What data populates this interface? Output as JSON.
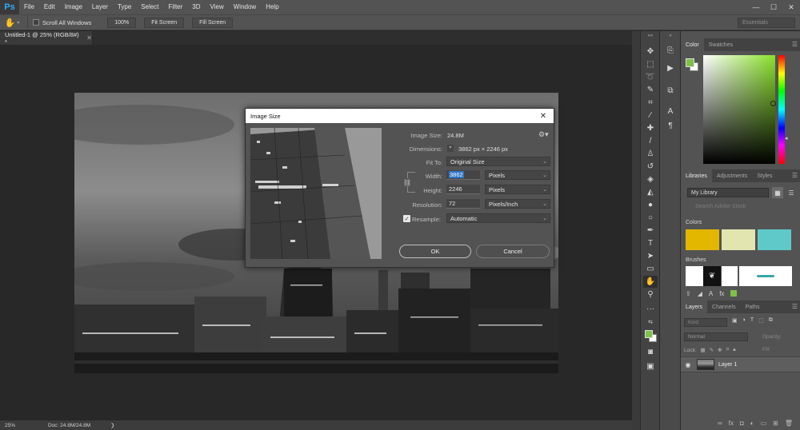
{
  "app": {
    "logo": "Ps"
  },
  "menu": [
    "File",
    "Edit",
    "Image",
    "Layer",
    "Type",
    "Select",
    "Filter",
    "3D",
    "View",
    "Window",
    "Help"
  ],
  "window_controls": {
    "minimize": "—",
    "maximize": "☐",
    "close": "✕"
  },
  "options_bar": {
    "scroll_all_label": "Scroll All Windows",
    "zoom_100_label": "100%",
    "fit_screen_label": "Fit Screen",
    "fill_screen_label": "Fill Screen",
    "workspace": "Essentials"
  },
  "document": {
    "tab_title": "Untitled-1 @ 25% (RGB/8#) *",
    "zoom": "25%",
    "doc_info": "Doc: 24.8M/24.8M"
  },
  "panels": {
    "color": {
      "tabs": [
        "Color",
        "Swatches"
      ],
      "foreground": "#7fc04a",
      "background": "#ffffff"
    },
    "libraries": {
      "tabs": [
        "Libraries",
        "Adjustments",
        "Styles"
      ],
      "selected_library": "My Library",
      "search_placeholder": "Search Adobe Stock",
      "colors_heading": "Colors",
      "colors": [
        "#e3b600",
        "#e3e5b0",
        "#5fc9c9"
      ],
      "brushes_heading": "Brushes"
    },
    "layers": {
      "tabs": [
        "Layers",
        "Channels",
        "Paths"
      ],
      "filter_label": "Kind",
      "blend_mode": "Normal",
      "opacity_label": "Opacity:",
      "lock_label": "Lock:",
      "fill_label": "Fill:",
      "layer_name": "Layer 1"
    }
  },
  "dialog": {
    "title": "Image Size",
    "image_size_label": "Image Size:",
    "image_size_value": "24.8M",
    "dimensions_label": "Dimensions:",
    "dimensions_value": "3862 px  ×  2246 px",
    "fit_to_label": "Fit To:",
    "fit_to_value": "Original Size",
    "width_label": "Width:",
    "width_value": "3862",
    "width_unit": "Pixels",
    "height_label": "Height:",
    "height_value": "2246",
    "height_unit": "Pixels",
    "resolution_label": "Resolution:",
    "resolution_value": "72",
    "resolution_unit": "Pixels/Inch",
    "resample_label": "Resample:",
    "resample_value": "Automatic",
    "resample_checked": true,
    "ok_label": "OK",
    "cancel_label": "Cancel"
  }
}
